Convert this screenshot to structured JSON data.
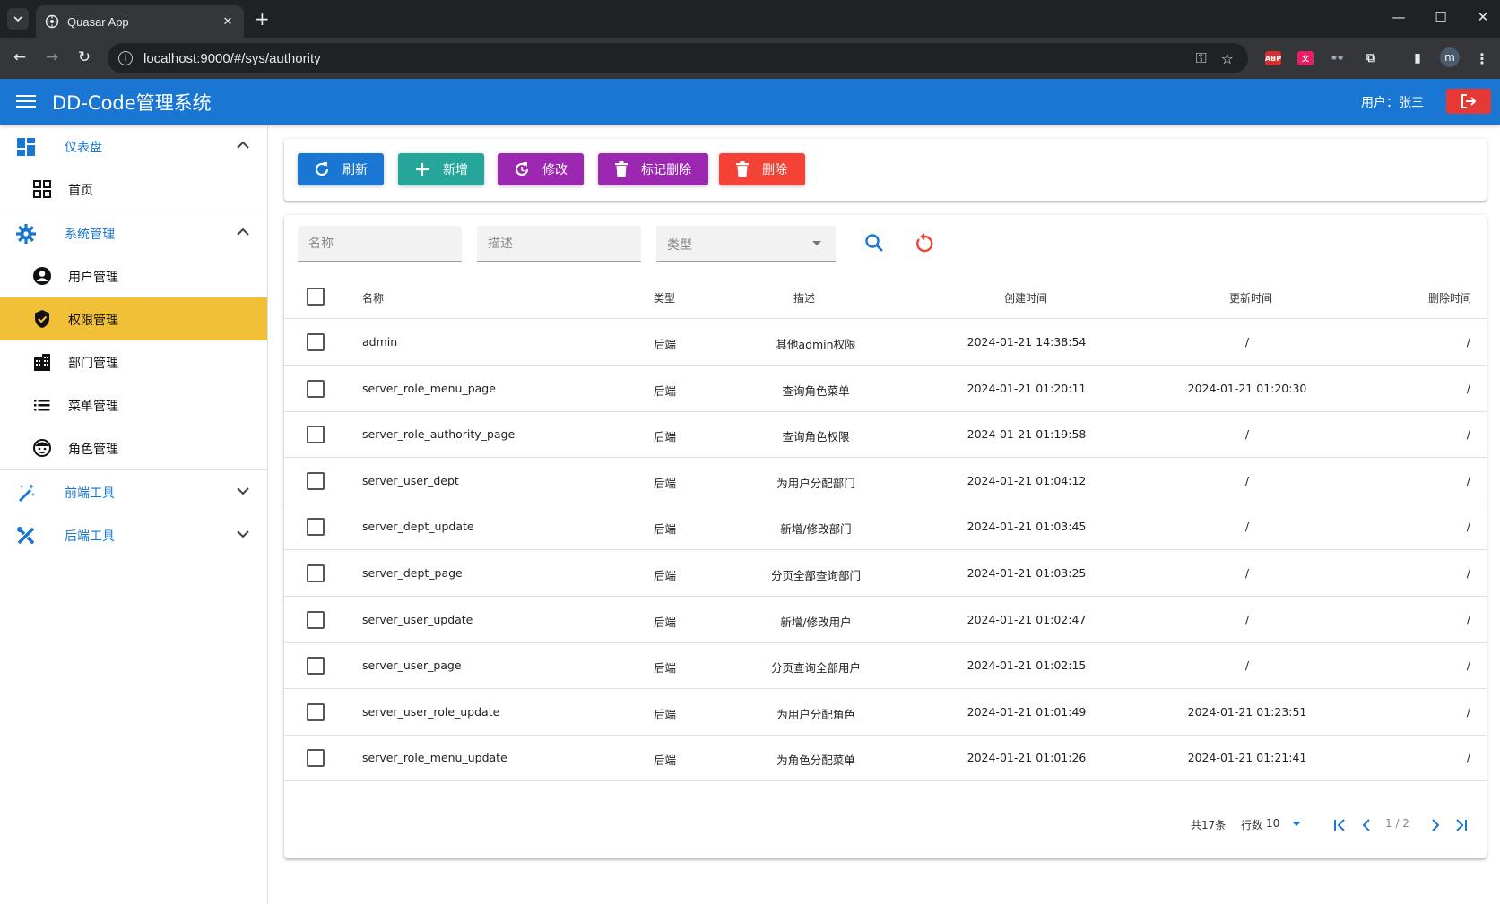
{
  "browser": {
    "tab_title": "Quasar App",
    "url": "localhost:9000/#/sys/authority",
    "profile_initial": "m",
    "ext_abp": "ABP"
  },
  "header": {
    "title": "DD-Code管理系统",
    "user_label": "用户：张三",
    "color": "#1976d2"
  },
  "sidebar": {
    "groups": [
      {
        "label": "仪表盘",
        "icon": "dashboard-icon",
        "expanded": true,
        "items": [
          {
            "label": "首页",
            "icon": "grid-icon"
          }
        ]
      },
      {
        "label": "系统管理",
        "icon": "gear-icon",
        "expanded": true,
        "items": [
          {
            "label": "用户管理",
            "icon": "account-circle-icon"
          },
          {
            "label": "权限管理",
            "icon": "shield-check-icon",
            "active": true
          },
          {
            "label": "部门管理",
            "icon": "building-icon"
          },
          {
            "label": "菜单管理",
            "icon": "list-icon"
          },
          {
            "label": "角色管理",
            "icon": "face-icon"
          }
        ]
      },
      {
        "label": "前端工具",
        "icon": "magic-wand-icon",
        "expanded": false
      },
      {
        "label": "后端工具",
        "icon": "tools-icon",
        "expanded": false
      }
    ],
    "active_color": "#f2c037"
  },
  "toolbar": {
    "refresh": "刷新",
    "add": "新增",
    "edit": "修改",
    "mark_delete": "标记删除",
    "delete": "删除"
  },
  "filters": {
    "name_placeholder": "名称",
    "desc_placeholder": "描述",
    "type_placeholder": "类型"
  },
  "table": {
    "columns": [
      "名称",
      "类型",
      "描述",
      "创建时间",
      "更新时间",
      "删除时间"
    ],
    "rows": [
      {
        "name": "admin",
        "type": "后端",
        "desc": "其他admin权限",
        "created": "2024-01-21 14:38:54",
        "updated": "/",
        "deleted": "/"
      },
      {
        "name": "server_role_menu_page",
        "type": "后端",
        "desc": "查询角色菜单",
        "created": "2024-01-21 01:20:11",
        "updated": "2024-01-21 01:20:30",
        "deleted": "/"
      },
      {
        "name": "server_role_authority_page",
        "type": "后端",
        "desc": "查询角色权限",
        "created": "2024-01-21 01:19:58",
        "updated": "/",
        "deleted": "/"
      },
      {
        "name": "server_user_dept",
        "type": "后端",
        "desc": "为用户分配部门",
        "created": "2024-01-21 01:04:12",
        "updated": "/",
        "deleted": "/"
      },
      {
        "name": "server_dept_update",
        "type": "后端",
        "desc": "新增/修改部门",
        "created": "2024-01-21 01:03:45",
        "updated": "/",
        "deleted": "/"
      },
      {
        "name": "server_dept_page",
        "type": "后端",
        "desc": "分页全部查询部门",
        "created": "2024-01-21 01:03:25",
        "updated": "/",
        "deleted": "/"
      },
      {
        "name": "server_user_update",
        "type": "后端",
        "desc": "新增/修改用户",
        "created": "2024-01-21 01:02:47",
        "updated": "/",
        "deleted": "/"
      },
      {
        "name": "server_user_page",
        "type": "后端",
        "desc": "分页查询全部用户",
        "created": "2024-01-21 01:02:15",
        "updated": "/",
        "deleted": "/"
      },
      {
        "name": "server_user_role_update",
        "type": "后端",
        "desc": "为用户分配角色",
        "created": "2024-01-21 01:01:49",
        "updated": "2024-01-21 01:23:51",
        "deleted": "/"
      },
      {
        "name": "server_role_menu_update",
        "type": "后端",
        "desc": "为角色分配菜单",
        "created": "2024-01-21 01:01:26",
        "updated": "2024-01-21 01:21:41",
        "deleted": "/"
      }
    ]
  },
  "pagination": {
    "total": "共17条",
    "rows_label": "行数",
    "rows_per_page": "10",
    "page_info": "1 / 2"
  }
}
